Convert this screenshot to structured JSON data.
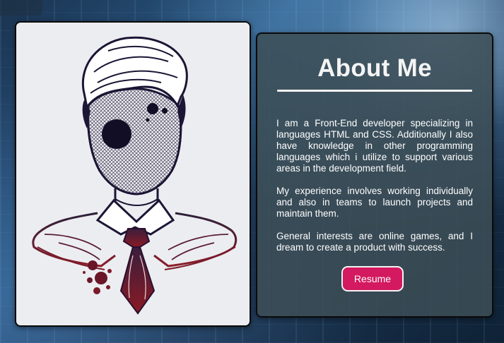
{
  "about": {
    "title": "About Me",
    "paragraphs": [
      "I am a Front-End developer specializing in languages HTML and CSS. Additionally I also have knowledge in other programming languages which i utilize to support various areas in the development field.",
      "My experience involves working individually and also in teams to launch projects and maintain them.",
      "General interests are online games, and I dream to create a product with success."
    ],
    "resume_label": "Resume"
  },
  "colors": {
    "card_background": "#3c4e56",
    "button": "#d3195f",
    "illustration_line": "#1c1535",
    "illustration_tie": "#7a1a2a"
  }
}
